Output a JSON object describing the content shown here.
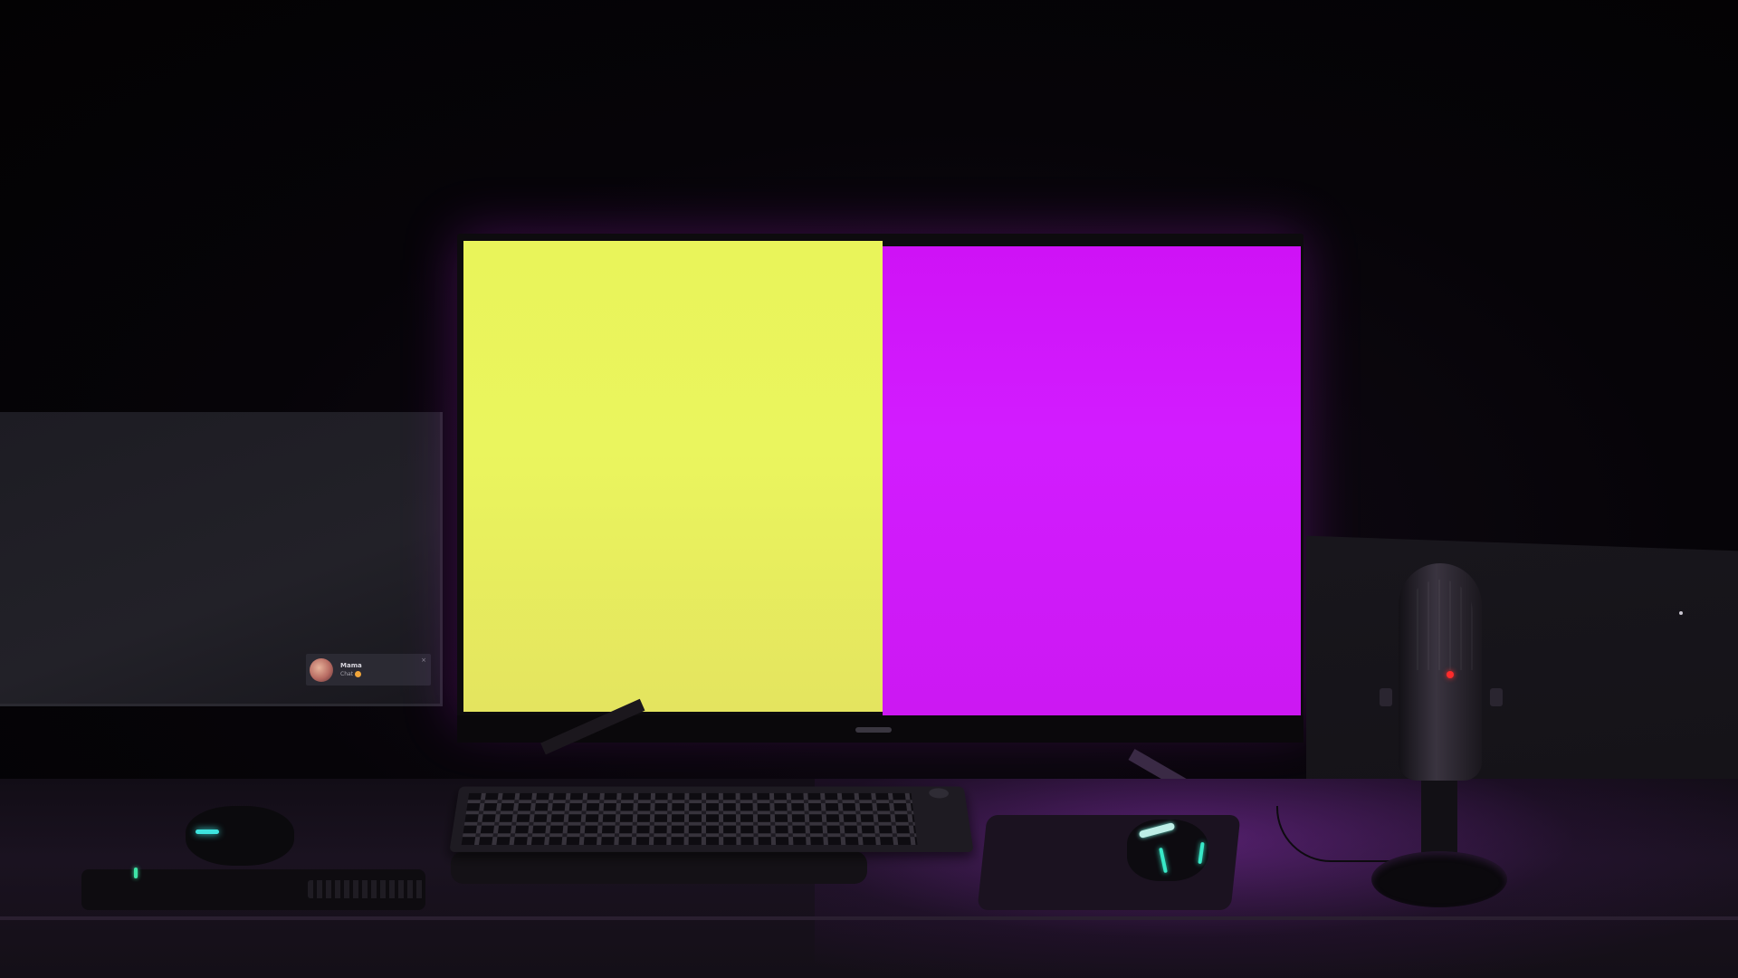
{
  "scene": {
    "description_colors": {
      "left_panel": "#e9f45a",
      "right_panel": "#d21cff",
      "mouse_led": "#38e9c8",
      "mic_led": "#ff2b2b"
    }
  },
  "left_monitor": {
    "notification": {
      "avatar_icon": "avatar",
      "name": "Mama",
      "message": "Chat",
      "emoji_icon": "emoji-icon",
      "close_glyph": "×"
    }
  },
  "icons": {
    "close": "close-icon",
    "mic_led": "led-indicator"
  }
}
